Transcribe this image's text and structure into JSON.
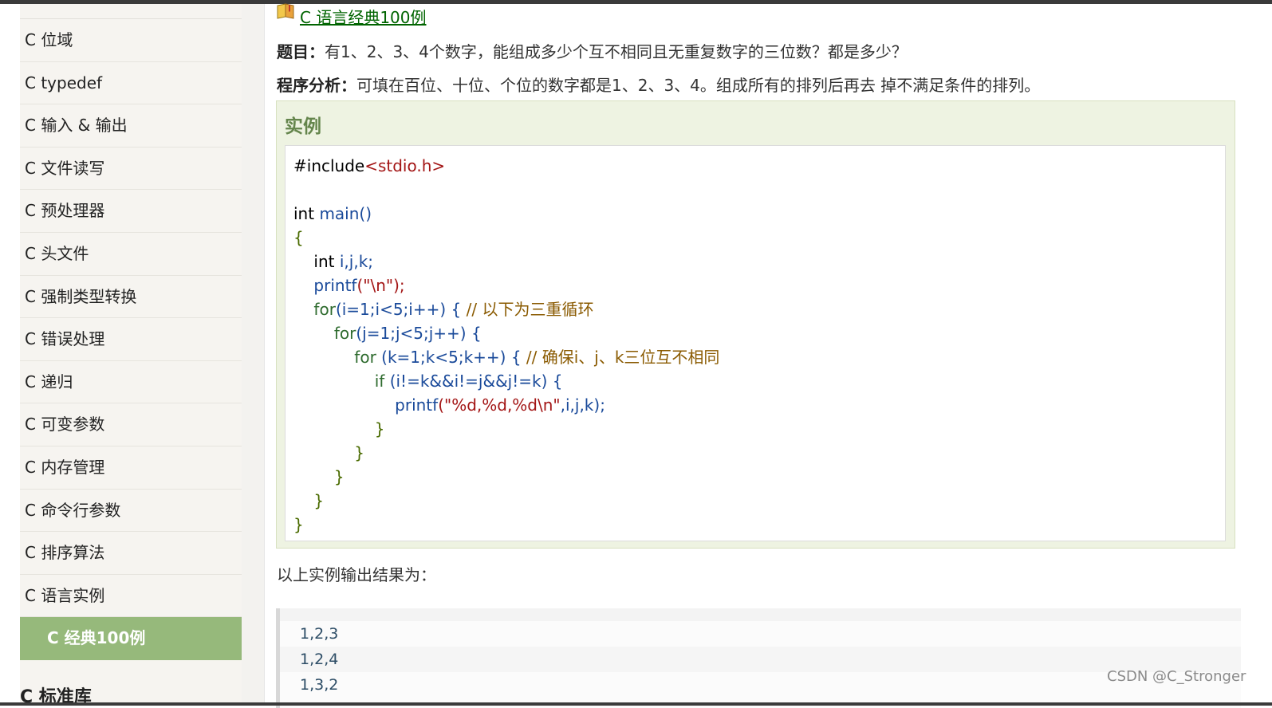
{
  "sidebar": {
    "items": [
      {
        "label": "C 位域"
      },
      {
        "label": "C typedef"
      },
      {
        "label": "C 输入 & 输出"
      },
      {
        "label": "C 文件读写"
      },
      {
        "label": "C 预处理器"
      },
      {
        "label": "C 头文件"
      },
      {
        "label": "C 强制类型转换"
      },
      {
        "label": "C 错误处理"
      },
      {
        "label": "C 递归"
      },
      {
        "label": "C 可变参数"
      },
      {
        "label": "C 内存管理"
      },
      {
        "label": "C 命令行参数"
      },
      {
        "label": "C 排序算法"
      },
      {
        "label": "C 语言实例"
      }
    ],
    "active_item": "C 经典100例",
    "partial_bottom": "C 标准库"
  },
  "breadcrumb": {
    "link": "C 语言经典100例"
  },
  "problem": {
    "label": "题目：",
    "text": "有1、2、3、4个数字，能组成多少个互不相同且无重复数字的三位数？都是多少？"
  },
  "analysis": {
    "label": "程序分析：",
    "text": "可填在百位、十位、个位的数字都是1、2、3、4。组成所有的排列后再去 掉不满足条件的排列。"
  },
  "example": {
    "title": "实例"
  },
  "code": {
    "l1_pre": "#include",
    "l1_hdr": "<stdio.h>",
    "l3_kw": "int ",
    "l3_fn": "main()",
    "l4": "{",
    "l5_kw": "    int ",
    "l5_rest": "i,j,k;",
    "l6_fn": "    printf",
    "l6_str": "(\"\\n\");",
    "l7_kw": "    for",
    "l7_rest": "(i=1;i<5;i++) { ",
    "l7_cm": "// 以下为三重循环",
    "l8_kw": "        for",
    "l8_rest": "(j=1;j<5;j++) {",
    "l9_kw": "            for ",
    "l9_rest": "(k=1;k<5;k++) { ",
    "l9_cm": "// 确保i、j、k三位互不相同",
    "l10_kw": "                if ",
    "l10_rest": "(i!=k&&i!=j&&j!=k) {",
    "l11_fn": "                    printf",
    "l11_str": "(\"%d,%d,%d\\n\"",
    "l11_rest": ",i,j,k);",
    "l12": "                }",
    "l13": "            }",
    "l14": "        }",
    "l15": "    }",
    "l16": "}"
  },
  "output": {
    "label": "以上实例输出结果为：",
    "lines": [
      "1,2,3",
      "1,2,4",
      "1,3,2"
    ]
  },
  "watermark": "CSDN @C_Stronger",
  "colors": {
    "active_bg": "#96b97b",
    "link_green": "#006400",
    "example_title": "#64854c"
  }
}
